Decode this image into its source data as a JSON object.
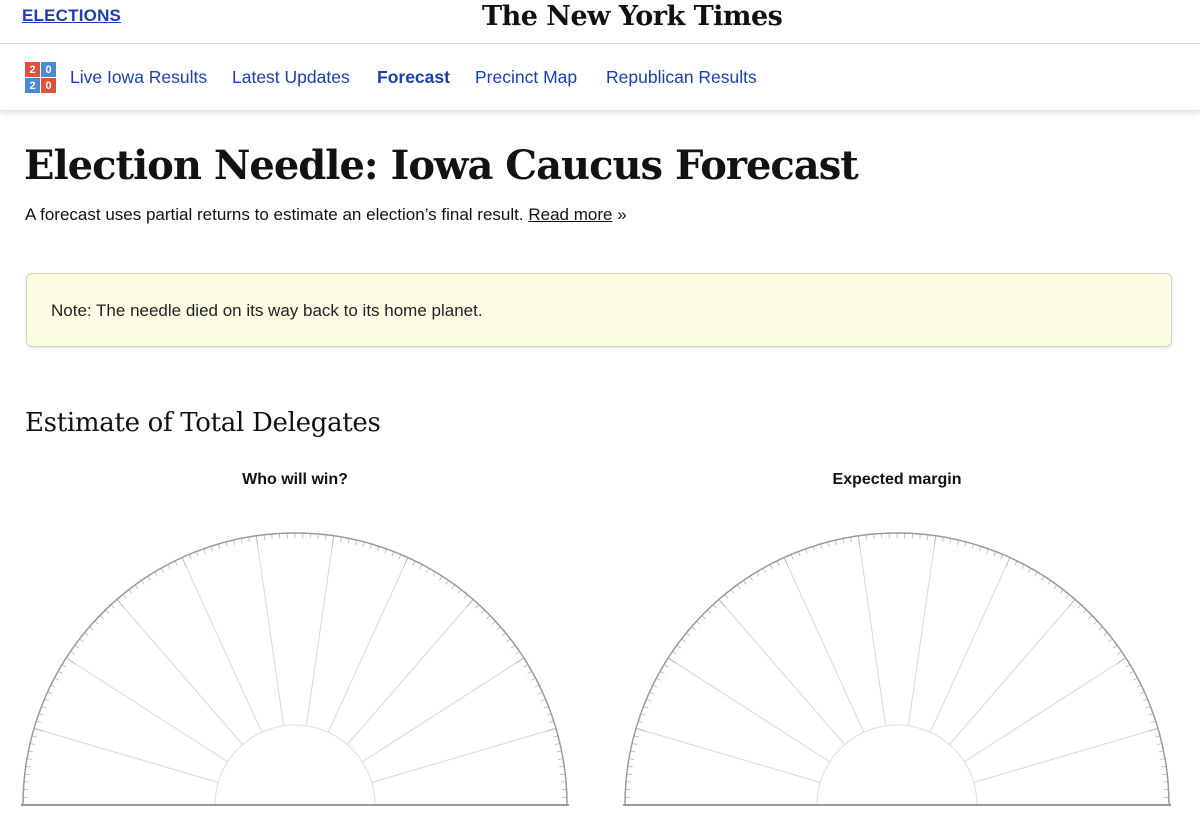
{
  "masthead": {
    "section_link": "ELECTIONS",
    "logo": "The New York Times"
  },
  "nav": {
    "badge": {
      "digits": [
        "2",
        "0",
        "2",
        "0"
      ],
      "colors": [
        "#e0523e",
        "#4b8ad6",
        "#4b8ad6",
        "#e0523e"
      ]
    },
    "items": [
      {
        "label": "Live Iowa Results",
        "active": false
      },
      {
        "label": "Latest Updates",
        "active": false
      },
      {
        "label": "Forecast",
        "active": true
      },
      {
        "label": "Precinct Map",
        "active": false
      },
      {
        "label": "Republican Results",
        "active": false
      }
    ]
  },
  "article": {
    "headline": "Election Needle: Iowa Caucus Forecast",
    "dek": "A forecast uses partial returns to estimate an election’s final result.",
    "read_more": "Read more",
    "read_more_suffix": "»"
  },
  "note": {
    "text": "Note: The needle died on its way back to its home planet."
  },
  "section": {
    "title": "Estimate of Total Delegates"
  },
  "gauges": [
    {
      "label": "Who will win?"
    },
    {
      "label": "Expected margin"
    }
  ],
  "colors": {
    "link": "#1a3fb4",
    "note_background": "#fdfde6",
    "gauge_line": "#999999"
  }
}
